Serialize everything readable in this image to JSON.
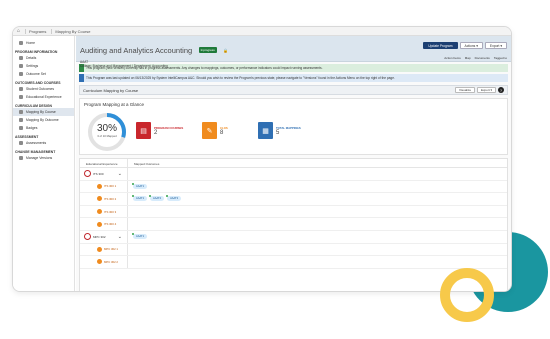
{
  "breadcrumb": {
    "home_icon": "home-icon",
    "items": [
      "Programs",
      "Mapping By Course"
    ]
  },
  "sidebar": {
    "items": [
      {
        "type": "item",
        "label": "Home",
        "icon": "home-icon"
      },
      {
        "type": "header",
        "label": "PROGRAM INFORMATION"
      },
      {
        "type": "item",
        "label": "Details",
        "icon": "info-icon"
      },
      {
        "type": "item",
        "label": "Settings",
        "icon": "gear-icon"
      },
      {
        "type": "item",
        "label": "Outcome Set",
        "icon": "list-icon"
      },
      {
        "type": "header",
        "label": "OUTCOMES AND COURSES"
      },
      {
        "type": "item",
        "label": "Student Outcomes",
        "icon": "people-icon"
      },
      {
        "type": "item",
        "label": "Educational Experience",
        "icon": "book-icon"
      },
      {
        "type": "header",
        "label": "CURRICULUM DESIGN"
      },
      {
        "type": "item",
        "label": "Mapping By Course",
        "icon": "map-icon",
        "active": true
      },
      {
        "type": "item",
        "label": "Mapping By Outcome",
        "icon": "map-icon"
      },
      {
        "type": "item",
        "label": "Badges",
        "icon": "badge-icon"
      },
      {
        "type": "header",
        "label": "ASSESSMENT"
      },
      {
        "type": "item",
        "label": "Assessments",
        "icon": "check-icon"
      },
      {
        "type": "header",
        "label": "CHANGE MANAGEMENT"
      },
      {
        "type": "item",
        "label": "Manage Versions",
        "icon": "versions-icon"
      }
    ]
  },
  "header": {
    "title": "Auditing and Analytics Accounting",
    "badge": "Inprogress",
    "code": "AAAT",
    "college": "College: Business and Management  |  Department: Accounting",
    "buttons": {
      "update": "Update Program",
      "actions": "Actions ▾",
      "export": "Export ▾"
    },
    "tools": [
      "Action Items",
      "Map",
      "Documents",
      "Tagged to"
    ]
  },
  "alerts": {
    "green": "This program (new version) currently has in progress assessments. Any changes to mappings, outcomes, or performance indicators could impact running assessments.",
    "blue": "This Program was last updated on 06/13/2025 by System IntelliCampus A&C. Should you wish to review the Program's previous state, please navigate to \"Versions\" found in the Actions Menu on the top right of the page."
  },
  "panel": {
    "title": "Curriculum Mapping by Course",
    "visualize": "Visualize",
    "export": "Export ▾",
    "help": "?"
  },
  "glance": {
    "title": "Program Mapping at a Glance",
    "percent": "30%",
    "percent_value": 0.3,
    "mapped_text": "3 of 10 Mapped",
    "stats": [
      {
        "label": "PROGRAM COURSES",
        "value": "2",
        "color": "#c9262c",
        "icon": "document-icon"
      },
      {
        "label": "CLOS",
        "value": "8",
        "color": "#f08b1e",
        "icon": "pencil-icon"
      },
      {
        "label": "TOTAL MAPPINGS",
        "value": "5",
        "color": "#2f6fb3",
        "icon": "map-icon"
      }
    ]
  },
  "grid": {
    "col1": "Educational Experience",
    "col2": "Mapped Outcomes",
    "rows": [
      {
        "kind": "program",
        "label": "ITS 300",
        "tags": []
      },
      {
        "kind": "course",
        "label": "ITS 300 1",
        "tags": [
          "AAAT1"
        ]
      },
      {
        "kind": "course",
        "label": "ITS 300 2",
        "tags": [
          "AAAT1",
          "AAAT2",
          "AAAT3"
        ]
      },
      {
        "kind": "course",
        "label": "ITS 300 3",
        "tags": []
      },
      {
        "kind": "course",
        "label": "ITS 300 4",
        "tags": []
      },
      {
        "kind": "program",
        "label": "MPC 302",
        "tags": [
          "AAAT1"
        ]
      },
      {
        "kind": "course",
        "label": "MPC 302 1",
        "tags": []
      },
      {
        "kind": "course",
        "label": "MPC 302 2",
        "tags": []
      }
    ]
  }
}
